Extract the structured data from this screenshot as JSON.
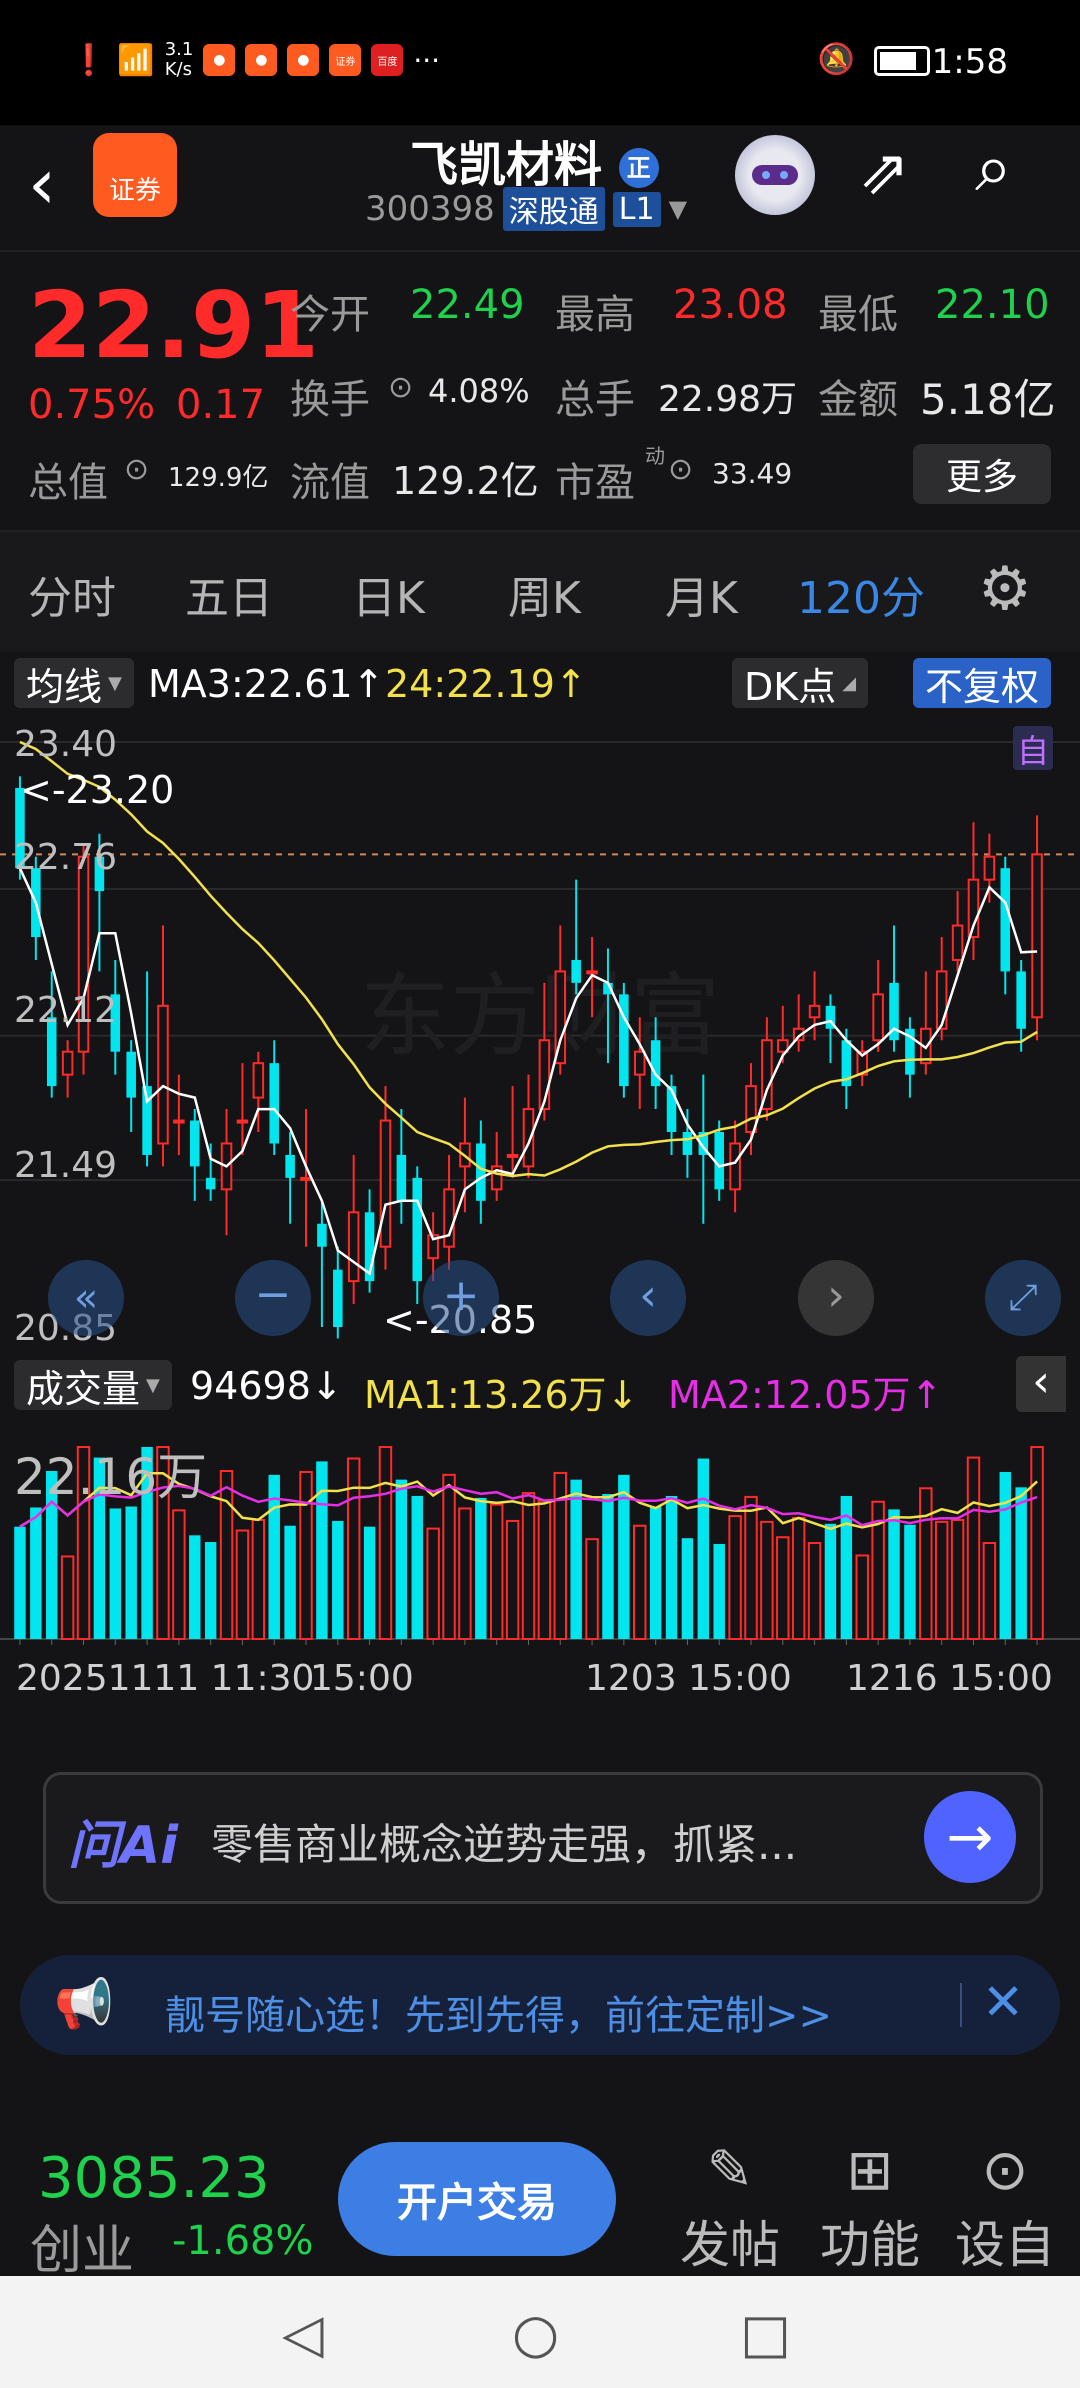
{
  "status": {
    "speed_value": "3.1",
    "speed_unit": "K/s",
    "more": "···",
    "time": "1:58",
    "app_icon_label_a": "证券",
    "app_icon_label_b": "百度"
  },
  "header": {
    "logo_label": "证券",
    "stock_name": "飞凯材料",
    "badge": "正",
    "code": "300398",
    "tag_connect": "深股通",
    "tag_level": "L1"
  },
  "quote": {
    "price": "22.91",
    "change_pct": "0.75%",
    "change_abs": "0.17",
    "open_label": "今开",
    "open_value": "22.49",
    "high_label": "最高",
    "high_value": "23.08",
    "low_label": "最低",
    "low_value": "22.10",
    "turnover_label": "换手",
    "turnover_value": "4.08%",
    "volume_label": "总手",
    "volume_value": "22.98万",
    "amount_label": "金额",
    "amount_value": "5.18亿",
    "mcap_label": "总值",
    "mcap_value": "129.9亿",
    "float_label": "流值",
    "float_value": "129.2亿",
    "pe_label": "市盈",
    "pe_sup": "动",
    "pe_value": "33.49",
    "more_label": "更多"
  },
  "tabs": [
    "分时",
    "五日",
    "日K",
    "周K",
    "月K",
    "120分"
  ],
  "chart_toolbar": {
    "indicator": "均线",
    "ma3_label": "MA3:22.61",
    "ma24_label": "24:22.19",
    "dk_label": "DK点",
    "adjust_label": "不复权",
    "auto_label": "自"
  },
  "price_axis": [
    "23.40",
    "22.76",
    "22.12",
    "21.49",
    "20.85"
  ],
  "annotations": {
    "high": "<-23.20",
    "low": "<-20.85"
  },
  "volume_toolbar": {
    "label": "成交量",
    "value": "94698",
    "ma1": "MA1:13.26万",
    "ma2": "MA2:12.05万",
    "max": "22.16万"
  },
  "x_axis": {
    "left": "20251111 11:30",
    "left2": "15:00",
    "mid": "1203 15:00",
    "right": "1216 15:00"
  },
  "ai_box": {
    "logo": "问Ai",
    "text": "零售商业概念逆势走强，抓紧..."
  },
  "banner": {
    "text": "靓号随心选！先到先得，前往定制>>"
  },
  "bottom": {
    "index_value": "3085.23",
    "index_name": "创业",
    "index_pct": "-1.68%",
    "trade_label": "开户交易",
    "post_label": "发帖",
    "func_label": "功能",
    "settings_label": "设自"
  },
  "colors": {
    "up": "#ff2b2b",
    "down": "#00e5ee",
    "ma_white": "#ffffff",
    "ma_yellow": "#f2e14c",
    "ma2_magenta": "#e62ee6",
    "accent": "#3b87e6"
  },
  "chart_data": {
    "type": "candlestick",
    "y_axis_ticks": [
      23.4,
      22.76,
      22.12,
      21.49,
      20.85
    ],
    "ylim": [
      20.85,
      23.4
    ],
    "candles": [
      [
        23.2,
        22.85,
        23.25,
        22.8
      ],
      [
        22.85,
        22.55,
        22.9,
        22.45
      ],
      [
        22.2,
        21.9,
        22.4,
        21.85
      ],
      [
        21.95,
        22.05,
        22.1,
        21.85
      ],
      [
        22.05,
        22.9,
        22.95,
        21.95
      ],
      [
        22.9,
        22.75,
        23.0,
        22.4
      ],
      [
        22.3,
        22.05,
        22.45,
        21.95
      ],
      [
        22.05,
        21.85,
        22.1,
        21.7
      ],
      [
        21.9,
        21.6,
        22.4,
        21.55
      ],
      [
        21.65,
        22.25,
        22.6,
        21.55
      ],
      [
        21.75,
        21.75,
        21.95,
        21.6
      ],
      [
        21.75,
        21.55,
        21.8,
        21.4
      ],
      [
        21.5,
        21.45,
        21.65,
        21.4
      ],
      [
        21.45,
        21.65,
        21.8,
        21.25
      ],
      [
        21.75,
        21.75,
        22.0,
        21.6
      ],
      [
        21.85,
        22.0,
        22.05,
        21.7
      ],
      [
        22.0,
        21.65,
        22.1,
        21.6
      ],
      [
        21.6,
        21.5,
        21.7,
        21.3
      ],
      [
        21.5,
        21.5,
        21.8,
        21.2
      ],
      [
        21.3,
        21.2,
        21.4,
        20.85
      ],
      [
        21.1,
        20.85,
        21.2,
        20.8
      ],
      [
        21.05,
        21.35,
        21.6,
        20.95
      ],
      [
        21.35,
        21.05,
        21.45,
        21.0
      ],
      [
        21.2,
        21.75,
        21.9,
        21.1
      ],
      [
        21.6,
        21.4,
        21.8,
        21.3
      ],
      [
        21.5,
        21.05,
        21.55,
        20.95
      ],
      [
        21.15,
        21.25,
        21.35,
        21.05
      ],
      [
        21.2,
        21.45,
        21.6,
        21.1
      ],
      [
        21.55,
        21.65,
        21.85,
        21.35
      ],
      [
        21.65,
        21.4,
        21.75,
        21.3
      ],
      [
        21.45,
        21.55,
        21.7,
        21.4
      ],
      [
        21.6,
        21.6,
        21.9,
        21.5
      ],
      [
        21.55,
        21.8,
        21.95,
        21.5
      ],
      [
        21.8,
        22.1,
        22.35,
        21.75
      ],
      [
        22.0,
        22.4,
        22.6,
        21.95
      ],
      [
        22.45,
        22.35,
        22.8,
        22.3
      ],
      [
        22.4,
        22.4,
        22.55,
        22.2
      ],
      [
        22.35,
        22.3,
        22.5,
        22.0
      ],
      [
        22.3,
        21.9,
        22.35,
        21.85
      ],
      [
        21.95,
        22.05,
        22.2,
        21.8
      ],
      [
        22.1,
        21.9,
        22.2,
        21.8
      ],
      [
        21.9,
        21.7,
        21.95,
        21.6
      ],
      [
        21.7,
        21.6,
        21.8,
        21.5
      ],
      [
        21.7,
        21.6,
        21.95,
        21.3
      ],
      [
        21.7,
        21.45,
        21.75,
        21.4
      ],
      [
        21.45,
        21.65,
        21.75,
        21.35
      ],
      [
        21.7,
        21.9,
        22.0,
        21.6
      ],
      [
        21.8,
        22.1,
        22.2,
        21.75
      ],
      [
        22.05,
        22.1,
        22.25,
        22.0
      ],
      [
        22.1,
        22.15,
        22.3,
        22.05
      ],
      [
        22.2,
        22.25,
        22.4,
        22.1
      ],
      [
        22.25,
        22.15,
        22.3,
        22.0
      ],
      [
        22.1,
        21.9,
        22.15,
        21.8
      ],
      [
        21.95,
        22.05,
        22.1,
        21.9
      ],
      [
        22.1,
        22.3,
        22.45,
        22.05
      ],
      [
        22.35,
        22.1,
        22.6,
        22.05
      ],
      [
        22.15,
        21.95,
        22.2,
        21.85
      ],
      [
        22.0,
        22.15,
        22.4,
        21.95
      ],
      [
        22.15,
        22.4,
        22.55,
        22.1
      ],
      [
        22.45,
        22.6,
        22.75,
        22.4
      ],
      [
        22.55,
        22.8,
        23.05,
        22.45
      ],
      [
        22.8,
        22.9,
        23.0,
        22.7
      ],
      [
        22.85,
        22.4,
        22.9,
        22.3
      ],
      [
        22.4,
        22.15,
        22.45,
        22.05
      ],
      [
        22.2,
        22.91,
        23.08,
        22.1
      ]
    ],
    "volume": {
      "max_label": "22.16万"
    }
  }
}
